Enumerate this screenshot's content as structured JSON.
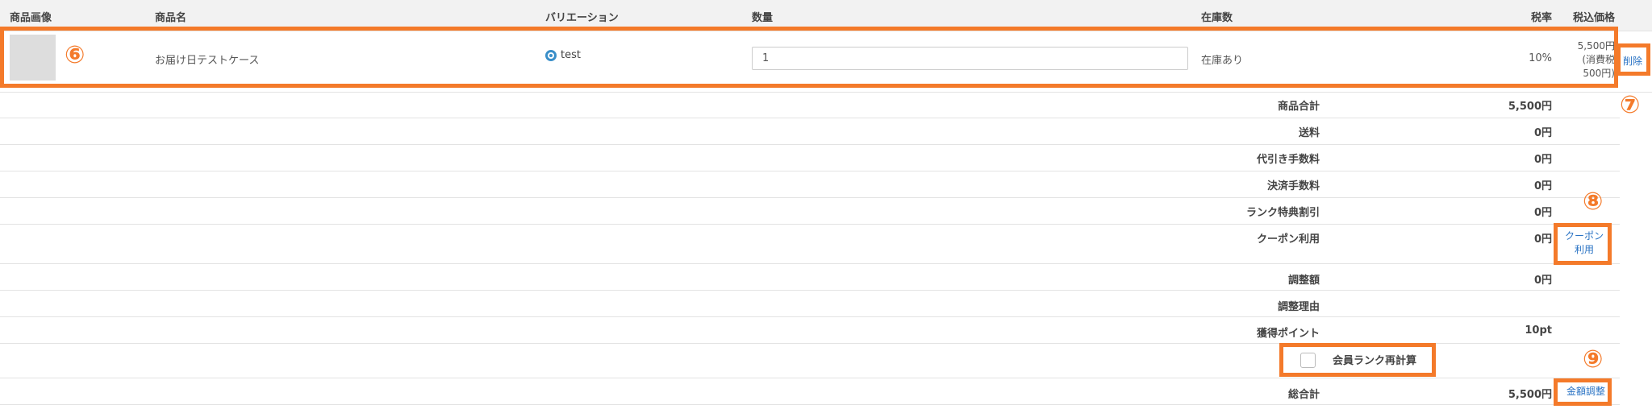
{
  "table": {
    "headers": {
      "image": "商品画像",
      "name": "商品名",
      "variation": "バリエーション",
      "quantity": "数量",
      "stock": "在庫数",
      "tax_rate": "税率",
      "price_incl": "税込価格"
    },
    "product": {
      "name": "お届け日テストケース",
      "variation": "test",
      "quantity": "1",
      "stock": "在庫あり",
      "tax_rate": "10%",
      "price_line1": "5,500円",
      "price_line2": "(消費税",
      "price_line3": "500円)",
      "delete_label": "削除"
    }
  },
  "summary": {
    "subtotal_label": "商品合計",
    "subtotal_value": "5,500円",
    "shipping_label": "送料",
    "shipping_value": "0円",
    "cod_fee_label": "代引き手数料",
    "cod_fee_value": "0円",
    "payment_fee_label": "決済手数料",
    "payment_fee_value": "0円",
    "rank_discount_label": "ランク特典割引",
    "rank_discount_value": "0円",
    "coupon_label": "クーポン利用",
    "coupon_value": "0円",
    "coupon_button_line1": "クーポン",
    "coupon_button_line2": "利用",
    "adjustment_label": "調整額",
    "adjustment_value": "0円",
    "adjustment_reason_label": "調整理由",
    "points_label": "獲得ポイント",
    "points_value": "10pt",
    "rank_recalc_label": "会員ランク再計算",
    "total_label": "総合計",
    "total_value": "5,500円",
    "adjust_amount_label": "金額調整"
  },
  "annotations": {
    "n6": "⑥",
    "n7": "⑦",
    "n8": "⑧",
    "n9": "⑨"
  },
  "colors": {
    "highlight": "#f47a2a",
    "link": "#2a73c4",
    "header_bg": "#f2f2f2",
    "radio": "#3a8fc9"
  },
  "icons": {
    "variation_radio": "radio-selected-icon"
  }
}
